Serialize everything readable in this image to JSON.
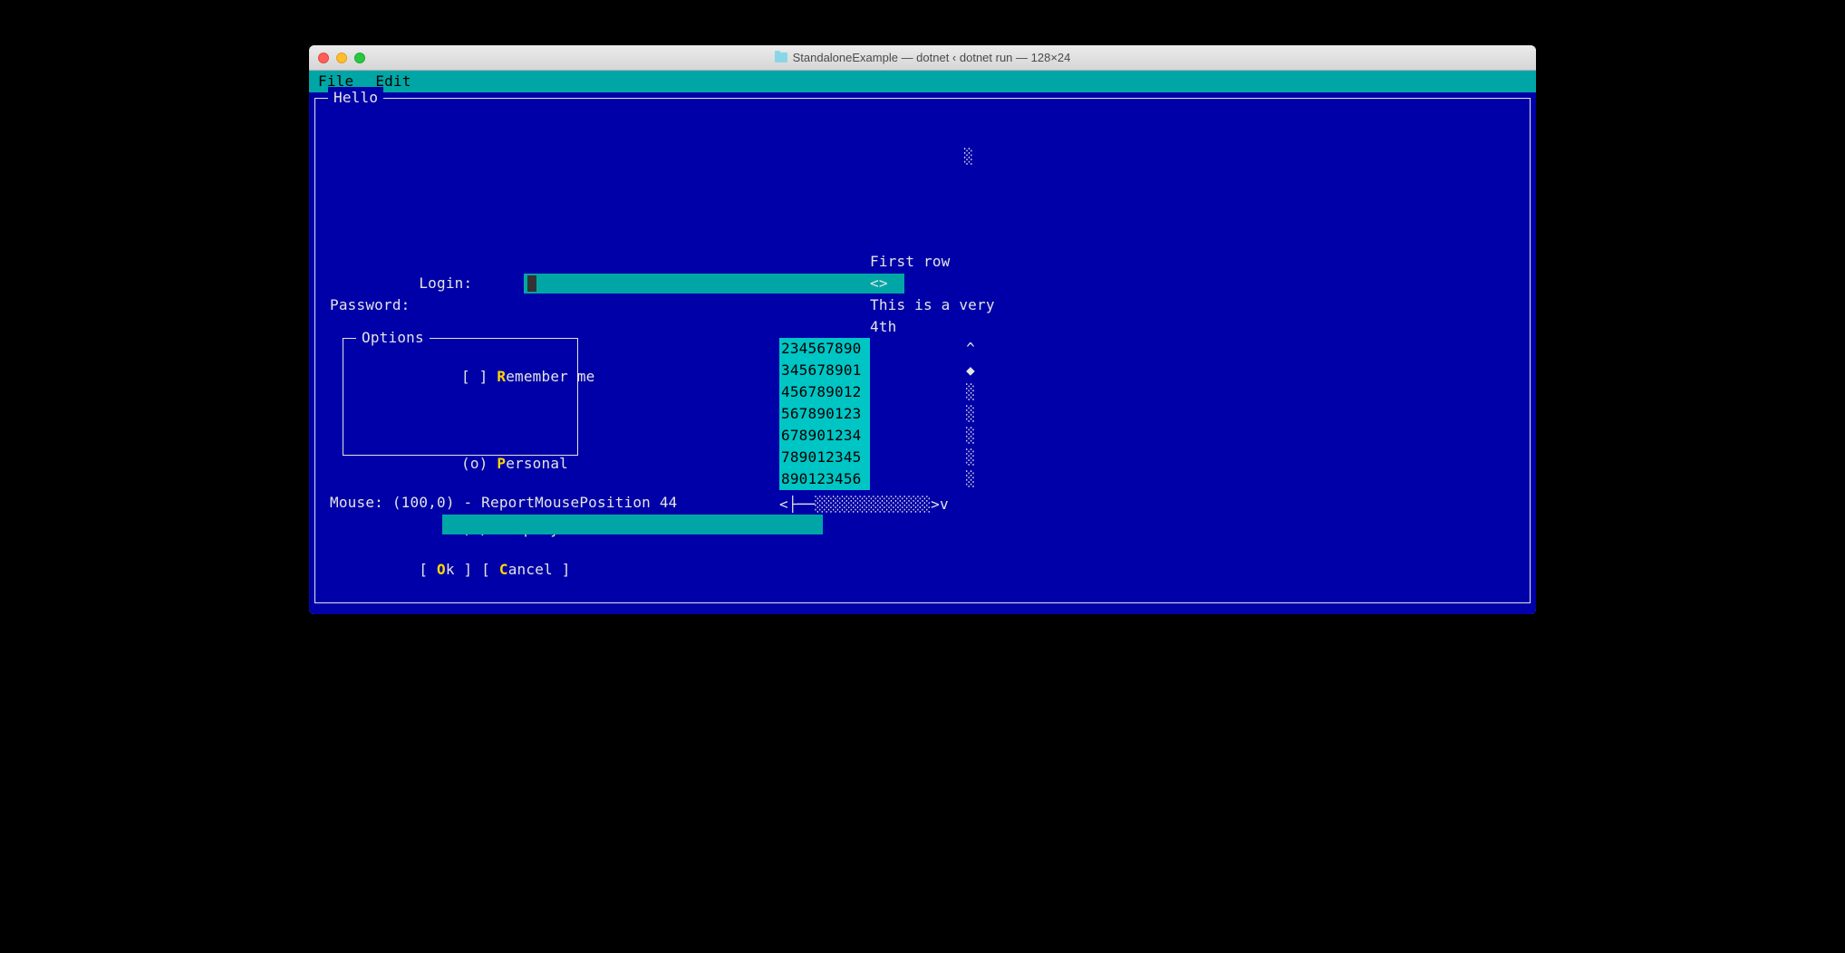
{
  "window_title": "StandaloneExample — dotnet ‹ dotnet run — 128×24",
  "menu": {
    "file": "File",
    "edit": "Edit"
  },
  "frame_title": "Hello",
  "labels": {
    "login": "Login: ",
    "password": "Password:"
  },
  "login_value": "",
  "password_value": "",
  "list_right": {
    "r1": "First row",
    "r2": "<>",
    "r3": "This is a very",
    "r4": "4th"
  },
  "options": {
    "title": "Options",
    "remember_prefix": "[ ] ",
    "remember_hot": "R",
    "remember_rest": "emember me",
    "personal_prefix": "(o) ",
    "personal_hot": "P",
    "personal_rest": "ersonal",
    "company_prefix": "( ) ",
    "company_hot": "C",
    "company_rest": "ompany"
  },
  "scroll_list": [
    "234567890",
    "345678901",
    "456789012",
    "567890123",
    "678901234",
    "789012345",
    "890123456"
  ],
  "vscroll": {
    "up": "^",
    "thumb": "◆",
    "track": "░",
    "down": "v"
  },
  "hscroll": "<├──░░░░░░░░░░░░░>v",
  "top_track_glyph": "░",
  "mouse_status": "Mouse: (100,0) - ReportMousePosition 44",
  "buttons": {
    "ok_l": "[ ",
    "ok_hot": "O",
    "ok_rest": "k ]",
    "gap": " ",
    "cancel_l": "[ ",
    "cancel_hot": "C",
    "cancel_rest": "ancel ]"
  }
}
